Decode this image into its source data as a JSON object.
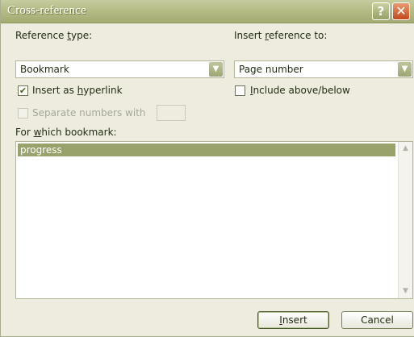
{
  "window": {
    "title": "Cross-reference",
    "help_glyph": "?",
    "close_glyph": "✕"
  },
  "reference_type": {
    "label_pre": "Reference ",
    "label_key": "t",
    "label_post": "ype:",
    "value": "Bookmark"
  },
  "insert_reference_to": {
    "label_pre": "Insert ",
    "label_key": "r",
    "label_post": "eference to:",
    "value": "Page number"
  },
  "insert_as_hyperlink": {
    "label_pre": "Insert as ",
    "label_key": "h",
    "label_post": "yperlink",
    "checked": true
  },
  "include_above_below": {
    "label_pre": "",
    "label_key": "I",
    "label_post": "nclude above/below",
    "checked": false
  },
  "separate_numbers": {
    "label": "Separate numbers with",
    "enabled": false
  },
  "for_which_bookmark": {
    "label_pre": "For ",
    "label_key": "w",
    "label_post": "hich bookmark:",
    "items": [
      "progress"
    ],
    "selected_index": 0
  },
  "buttons": {
    "insert_pre": "",
    "insert_key": "I",
    "insert_post": "nsert",
    "cancel": "Cancel"
  },
  "icons": {
    "dropdown": "chevron-down-icon",
    "check": "checkmark-icon",
    "scroll_up": "scroll-up-icon",
    "scroll_down": "scroll-down-icon"
  },
  "colors": {
    "titlebar": "#b5bc86",
    "selection": "#9aa26b",
    "close_button": "#c34a1c"
  }
}
